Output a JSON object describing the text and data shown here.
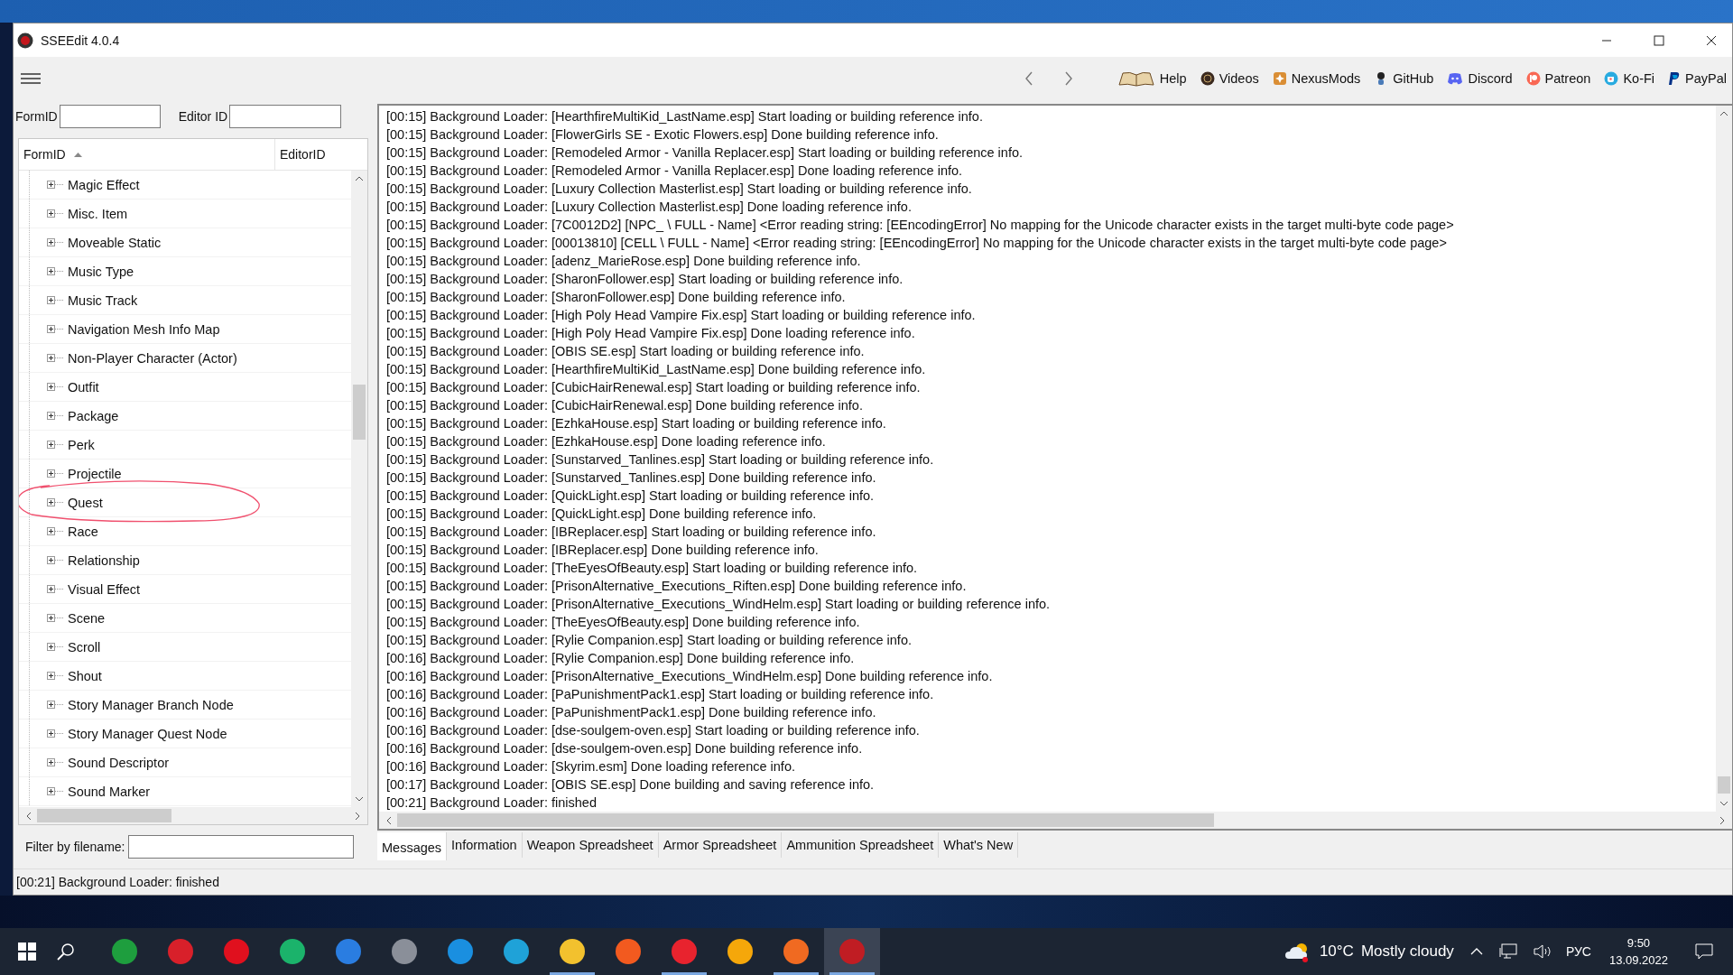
{
  "window": {
    "title": "SSEEdit 4.0.4"
  },
  "toolbar": {
    "links": [
      {
        "label": "Help"
      },
      {
        "label": "Videos"
      },
      {
        "label": "NexusMods"
      },
      {
        "label": "GitHub"
      },
      {
        "label": "Discord"
      },
      {
        "label": "Patreon"
      },
      {
        "label": "Ko-Fi"
      },
      {
        "label": "PayPal"
      }
    ]
  },
  "search": {
    "formid_label": "FormID",
    "editorid_label": "Editor ID"
  },
  "tree": {
    "columns": [
      "FormID",
      "EditorID"
    ],
    "items": [
      {
        "label": "Magic Effect",
        "expanded": false,
        "circled": false
      },
      {
        "label": "Misc. Item",
        "expanded": false,
        "circled": false
      },
      {
        "label": "Moveable Static",
        "expanded": false,
        "circled": false
      },
      {
        "label": "Music Type",
        "expanded": false,
        "circled": false
      },
      {
        "label": "Music Track",
        "expanded": false,
        "circled": false
      },
      {
        "label": "Navigation Mesh Info Map",
        "expanded": false,
        "circled": false
      },
      {
        "label": "Non-Player Character (Actor)",
        "expanded": false,
        "circled": false
      },
      {
        "label": "Outfit",
        "expanded": false,
        "circled": false
      },
      {
        "label": "Package",
        "expanded": false,
        "circled": false
      },
      {
        "label": "Perk",
        "expanded": false,
        "circled": false
      },
      {
        "label": "Projectile",
        "expanded": false,
        "circled": false
      },
      {
        "label": "Quest",
        "expanded": false,
        "circled": true
      },
      {
        "label": "Race",
        "expanded": false,
        "circled": false
      },
      {
        "label": "Relationship",
        "expanded": false,
        "circled": false
      },
      {
        "label": "Visual Effect",
        "expanded": false,
        "circled": false
      },
      {
        "label": "Scene",
        "expanded": false,
        "circled": false
      },
      {
        "label": "Scroll",
        "expanded": false,
        "circled": false
      },
      {
        "label": "Shout",
        "expanded": false,
        "circled": false
      },
      {
        "label": "Story Manager Branch Node",
        "expanded": false,
        "circled": false
      },
      {
        "label": "Story Manager Quest Node",
        "expanded": false,
        "circled": false
      },
      {
        "label": "Sound Descriptor",
        "expanded": false,
        "circled": false
      },
      {
        "label": "Sound Marker",
        "expanded": false,
        "circled": false
      }
    ]
  },
  "filter": {
    "label": "Filter by filename:"
  },
  "log": [
    "[00:15] Background Loader: [HearthfireMultiKid_LastName.esp] Start loading or building reference info.",
    "[00:15] Background Loader: [FlowerGirls SE - Exotic Flowers.esp] Done building reference info.",
    "[00:15] Background Loader: [Remodeled Armor - Vanilla Replacer.esp] Start loading or building reference info.",
    "[00:15] Background Loader: [Remodeled Armor - Vanilla Replacer.esp] Done loading reference info.",
    "[00:15] Background Loader: [Luxury Collection Masterlist.esp] Start loading or building reference info.",
    "[00:15] Background Loader: [Luxury Collection Masterlist.esp] Done loading reference info.",
    "[00:15] Background Loader: [7C0012D2] [NPC_ \\ FULL - Name] <Error reading string: [EEncodingError] No mapping for the Unicode character exists in the target multi-byte code page>",
    "[00:15] Background Loader: [00013810] [CELL \\ FULL - Name] <Error reading string: [EEncodingError] No mapping for the Unicode character exists in the target multi-byte code page>",
    "[00:15] Background Loader: [adenz_MarieRose.esp] Done building reference info.",
    "[00:15] Background Loader: [SharonFollower.esp] Start loading or building reference info.",
    "[00:15] Background Loader: [SharonFollower.esp] Done building reference info.",
    "[00:15] Background Loader: [High Poly Head Vampire Fix.esp] Start loading or building reference info.",
    "[00:15] Background Loader: [High Poly Head Vampire Fix.esp] Done loading reference info.",
    "[00:15] Background Loader: [OBIS SE.esp] Start loading or building reference info.",
    "[00:15] Background Loader: [HearthfireMultiKid_LastName.esp] Done building reference info.",
    "[00:15] Background Loader: [CubicHairRenewal.esp] Start loading or building reference info.",
    "[00:15] Background Loader: [CubicHairRenewal.esp] Done building reference info.",
    "[00:15] Background Loader: [EzhkaHouse.esp] Start loading or building reference info.",
    "[00:15] Background Loader: [EzhkaHouse.esp] Done loading reference info.",
    "[00:15] Background Loader: [Sunstarved_Tanlines.esp] Start loading or building reference info.",
    "[00:15] Background Loader: [Sunstarved_Tanlines.esp] Done building reference info.",
    "[00:15] Background Loader: [QuickLight.esp] Start loading or building reference info.",
    "[00:15] Background Loader: [QuickLight.esp] Done building reference info.",
    "[00:15] Background Loader: [IBReplacer.esp] Start loading or building reference info.",
    "[00:15] Background Loader: [IBReplacer.esp] Done building reference info.",
    "[00:15] Background Loader: [TheEyesOfBeauty.esp] Start loading or building reference info.",
    "[00:15] Background Loader: [PrisonAlternative_Executions_Riften.esp] Done building reference info.",
    "[00:15] Background Loader: [PrisonAlternative_Executions_WindHelm.esp] Start loading or building reference info.",
    "[00:15] Background Loader: [TheEyesOfBeauty.esp] Done building reference info.",
    "[00:15] Background Loader: [Rylie Companion.esp] Start loading or building reference info.",
    "[00:16] Background Loader: [Rylie Companion.esp] Done building reference info.",
    "[00:16] Background Loader: [PrisonAlternative_Executions_WindHelm.esp] Done building reference info.",
    "[00:16] Background Loader: [PaPunishmentPack1.esp] Start loading or building reference info.",
    "[00:16] Background Loader: [PaPunishmentPack1.esp] Done building reference info.",
    "[00:16] Background Loader: [dse-soulgem-oven.esp] Start loading or building reference info.",
    "[00:16] Background Loader: [dse-soulgem-oven.esp] Done building reference info.",
    "[00:16] Background Loader: [Skyrim.esm] Done loading reference info.",
    "[00:17] Background Loader: [OBIS SE.esp] Done building and saving reference info.",
    "[00:21] Background Loader: finished"
  ],
  "tabs": [
    {
      "label": "Messages",
      "selected": true
    },
    {
      "label": "Information",
      "selected": false
    },
    {
      "label": "Weapon Spreadsheet",
      "selected": false
    },
    {
      "label": "Armor Spreadsheet",
      "selected": false
    },
    {
      "label": "Ammunition Spreadsheet",
      "selected": false
    },
    {
      "label": "What's New",
      "selected": false
    }
  ],
  "status_bar": "[00:21] Background Loader: finished",
  "taskbar": {
    "apps": [
      {
        "color": "#1e9e3e",
        "running": false,
        "selected": false
      },
      {
        "color": "#d8202a",
        "running": false,
        "selected": false
      },
      {
        "color": "#e0101e",
        "running": false,
        "selected": false
      },
      {
        "color": "#1bb36b",
        "running": false,
        "selected": false
      },
      {
        "color": "#2a7de1",
        "running": false,
        "selected": false
      },
      {
        "color": "#8a8f99",
        "running": false,
        "selected": false
      },
      {
        "color": "#1a8fe0",
        "running": false,
        "selected": false
      },
      {
        "color": "#1fa2d8",
        "running": false,
        "selected": false
      },
      {
        "color": "#f2c12e",
        "running": true,
        "selected": false
      },
      {
        "color": "#f25a1f",
        "running": false,
        "selected": false
      },
      {
        "color": "#e8232e",
        "running": true,
        "selected": false
      },
      {
        "color": "#f5a70a",
        "running": false,
        "selected": false
      },
      {
        "color": "#f06a21",
        "running": true,
        "selected": false
      },
      {
        "color": "#c01d23",
        "running": true,
        "selected": true
      }
    ],
    "weather": {
      "temperature": "10°C",
      "condition": "Mostly cloudy"
    },
    "language": "РУС",
    "time": "9:50",
    "date": "13.09.2022"
  }
}
